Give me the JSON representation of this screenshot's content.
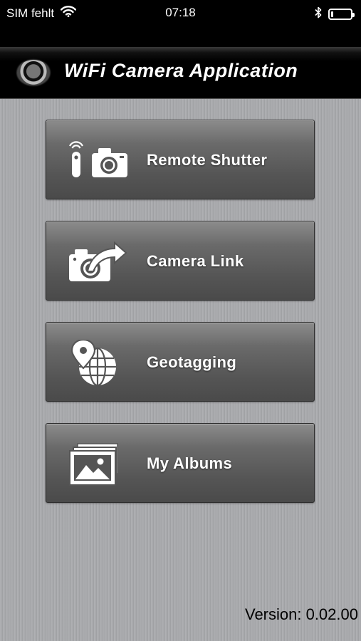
{
  "status_bar": {
    "carrier": "SIM fehlt",
    "time": "07:18",
    "wifi_icon": "wifi-icon",
    "bluetooth_icon": "bluetooth-icon",
    "battery_icon": "battery-icon",
    "battery_level": 0.12
  },
  "header": {
    "title": "WiFi Camera Application",
    "logo_icon": "camera-lens-icon"
  },
  "menu": [
    {
      "label": "Remote Shutter",
      "icon": "remote-shutter-icon"
    },
    {
      "label": "Camera Link",
      "icon": "camera-link-icon"
    },
    {
      "label": "Geotagging",
      "icon": "geotagging-icon"
    },
    {
      "label": "My Albums",
      "icon": "albums-icon"
    }
  ],
  "footer": {
    "version": "Version: 0.02.00"
  },
  "colors": {
    "background": "#a9aaad",
    "header": "#000000",
    "button": "#5e5e5e",
    "button_text": "#ffffff"
  }
}
